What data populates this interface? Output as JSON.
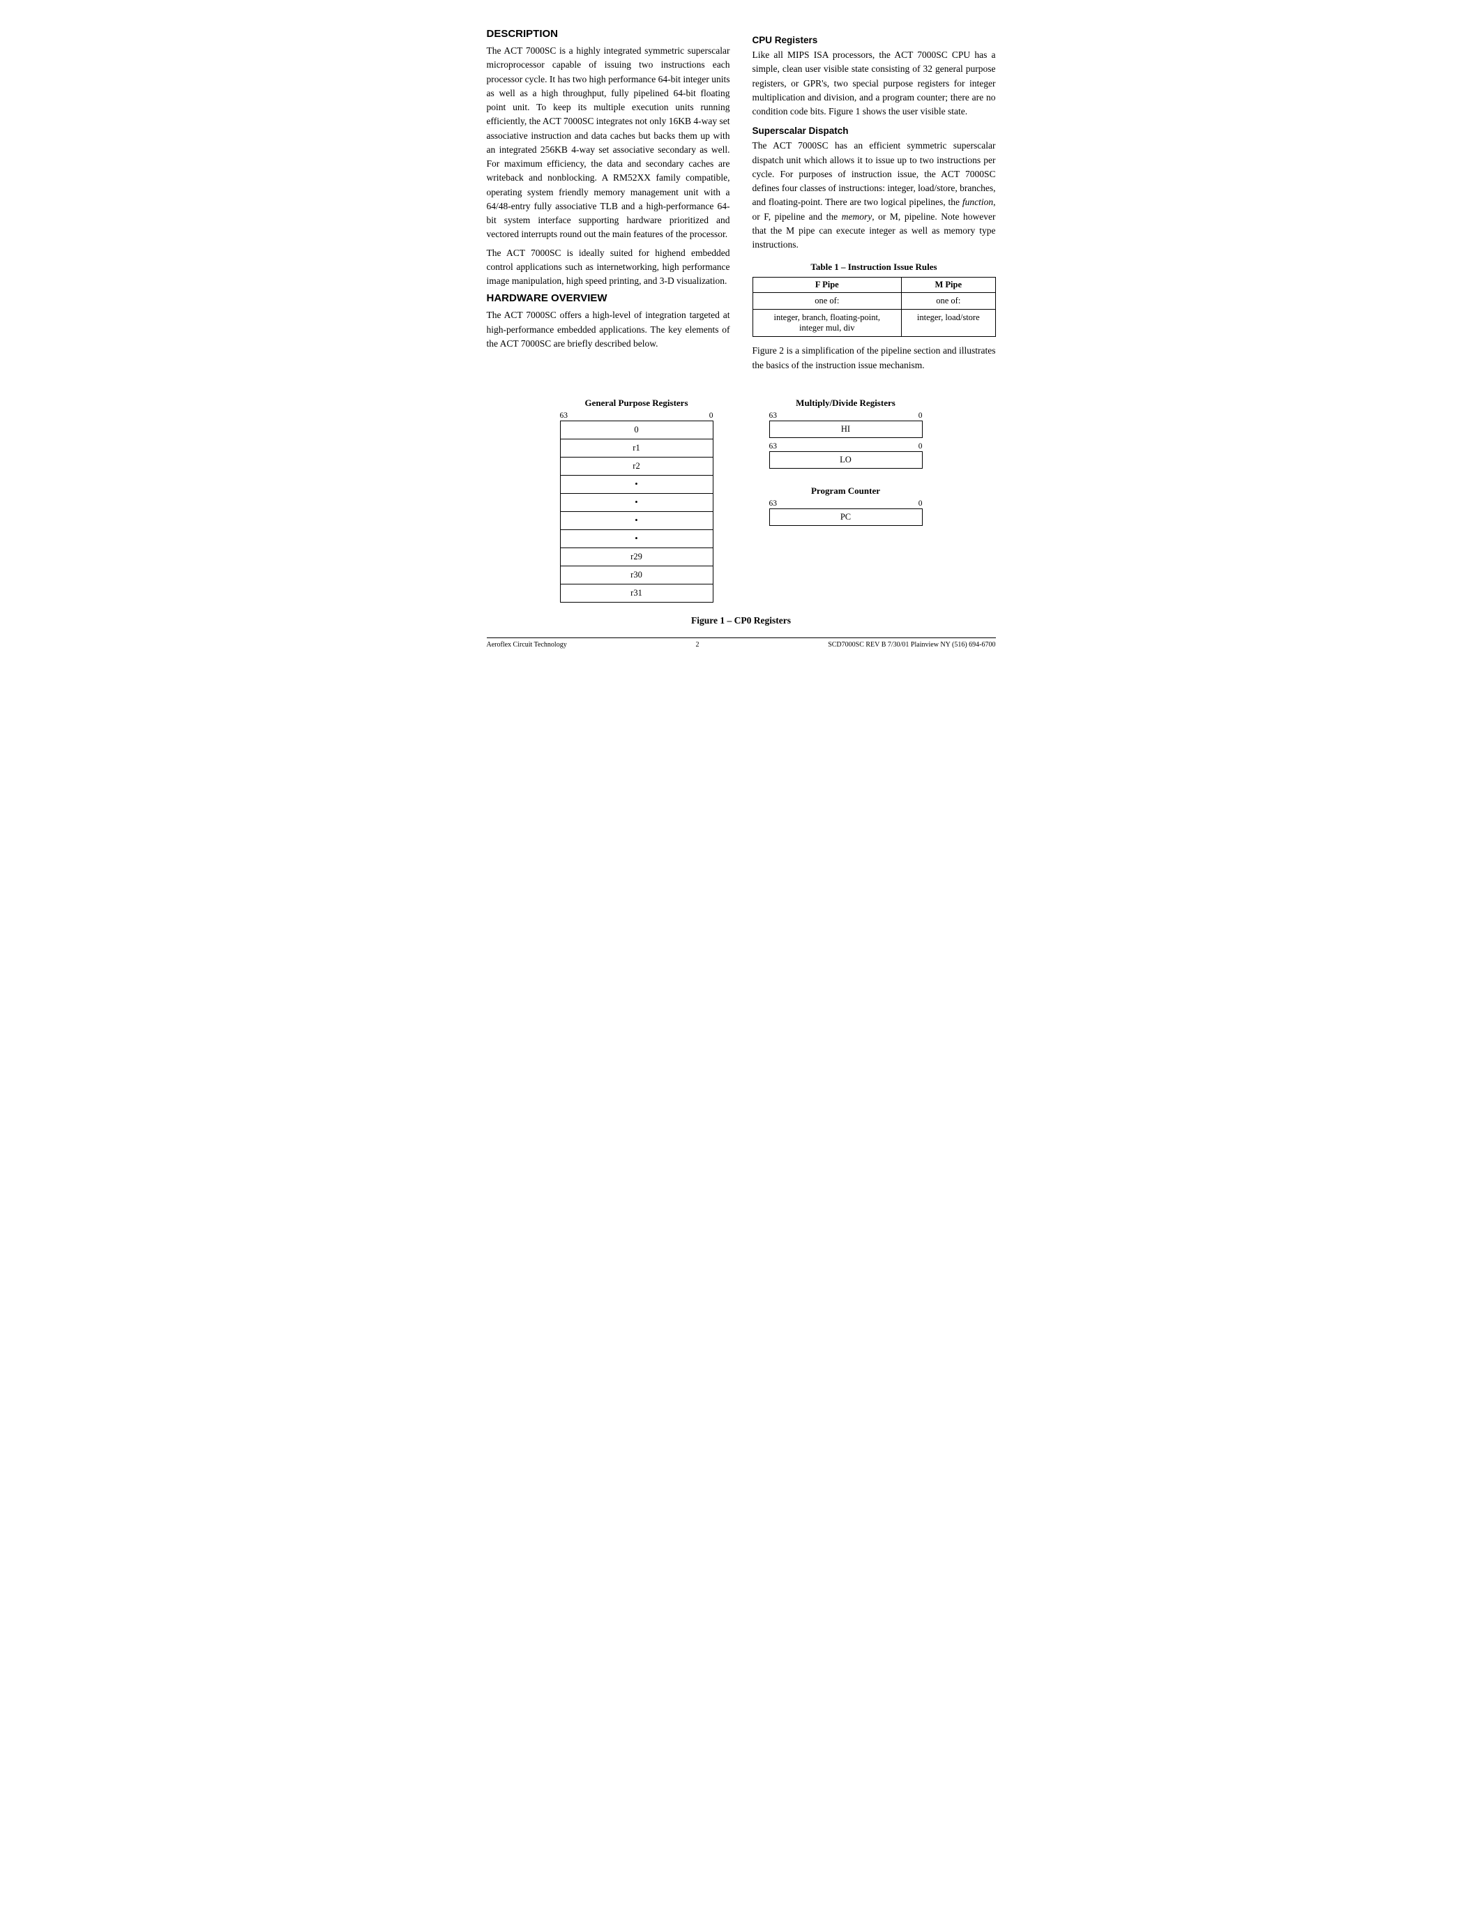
{
  "sections": {
    "description": {
      "title": "DESCRIPTION",
      "paragraphs": [
        "The ACT 7000SC is a highly integrated symmetric superscalar microprocessor capable of issuing two instructions each processor cycle. It has two high performance 64-bit integer units as well as a high throughput, fully pipelined 64-bit floating point unit. To keep its multiple execution units running efficiently, the ACT 7000SC integrates not only 16KB 4-way set associative instruction and data caches but backs them up with an integrated 256KB 4-way set associative secondary as well. For maximum efficiency, the data and secondary caches are writeback and nonblocking. A RM52XX family compatible, operating system friendly memory management unit with a 64/48-entry fully associative TLB and a high-performance 64-bit system interface supporting hardware prioritized and vectored interrupts round out the main features of the processor.",
        "The ACT 7000SC is ideally suited for highend embedded control applications such as internetworking, high performance image manipulation, high speed printing, and 3-D visualization."
      ]
    },
    "hardware_overview": {
      "title": "HARDWARE OVERVIEW",
      "paragraph": "The ACT 7000SC offers a high-level of integration targeted at high-performance embedded applications. The key elements of the ACT 7000SC are briefly described below."
    },
    "cpu_registers": {
      "title": "CPU Registers",
      "paragraph": "Like all MIPS ISA processors, the ACT 7000SC CPU has a simple, clean user visible state consisting of 32 general purpose registers, or GPR's, two special purpose registers for integer multiplication and division, and a program counter; there are no condition code bits. Figure 1 shows the user visible state."
    },
    "superscalar_dispatch": {
      "title": "Superscalar Dispatch",
      "paragraph": "The ACT 7000SC has an efficient symmetric superscalar dispatch unit which allows it to issue up to two instructions per cycle. For purposes of instruction issue, the ACT 7000SC defines four classes of instructions: integer, load/store, branches, and floating-point. There are two logical pipelines, the function, or F, pipeline and the memory, or M, pipeline. Note however that the M pipe can execute integer as well as memory type instructions."
    },
    "table1": {
      "title": "Table 1 – Instruction Issue Rules",
      "headers": [
        "F Pipe",
        "M Pipe"
      ],
      "rows": [
        [
          "one of:",
          "one of:"
        ],
        [
          "integer, branch, floating-point,\ninteger mul, div",
          "integer, load/store"
        ]
      ]
    },
    "figure_note": "Figure 2 is a simplification of the pipeline section and illustrates the basics of the instruction issue mechanism.",
    "figure": {
      "caption": "Figure 1 – CP0 Registers",
      "gpr": {
        "title": "General Purpose Registers",
        "bit_high": "63",
        "bit_low": "0",
        "rows": [
          "0",
          "r1",
          "r2",
          "•",
          "•",
          "•",
          "•",
          "r29",
          "r30",
          "r31"
        ]
      },
      "multiply_divide": {
        "title": "Multiply/Divide Registers",
        "registers": [
          {
            "label": "HI",
            "bit_high": "63",
            "bit_low": "0"
          },
          {
            "label": "LO",
            "bit_high": "63",
            "bit_low": "0"
          }
        ]
      },
      "program_counter": {
        "title": "Program Counter",
        "bit_high": "63",
        "bit_low": "0",
        "label": "PC"
      }
    },
    "footer": {
      "left": "Aeroflex Circuit Technology",
      "center": "2",
      "right": "SCD7000SC REV B  7/30/01  Plainview NY (516) 694-6700"
    }
  }
}
